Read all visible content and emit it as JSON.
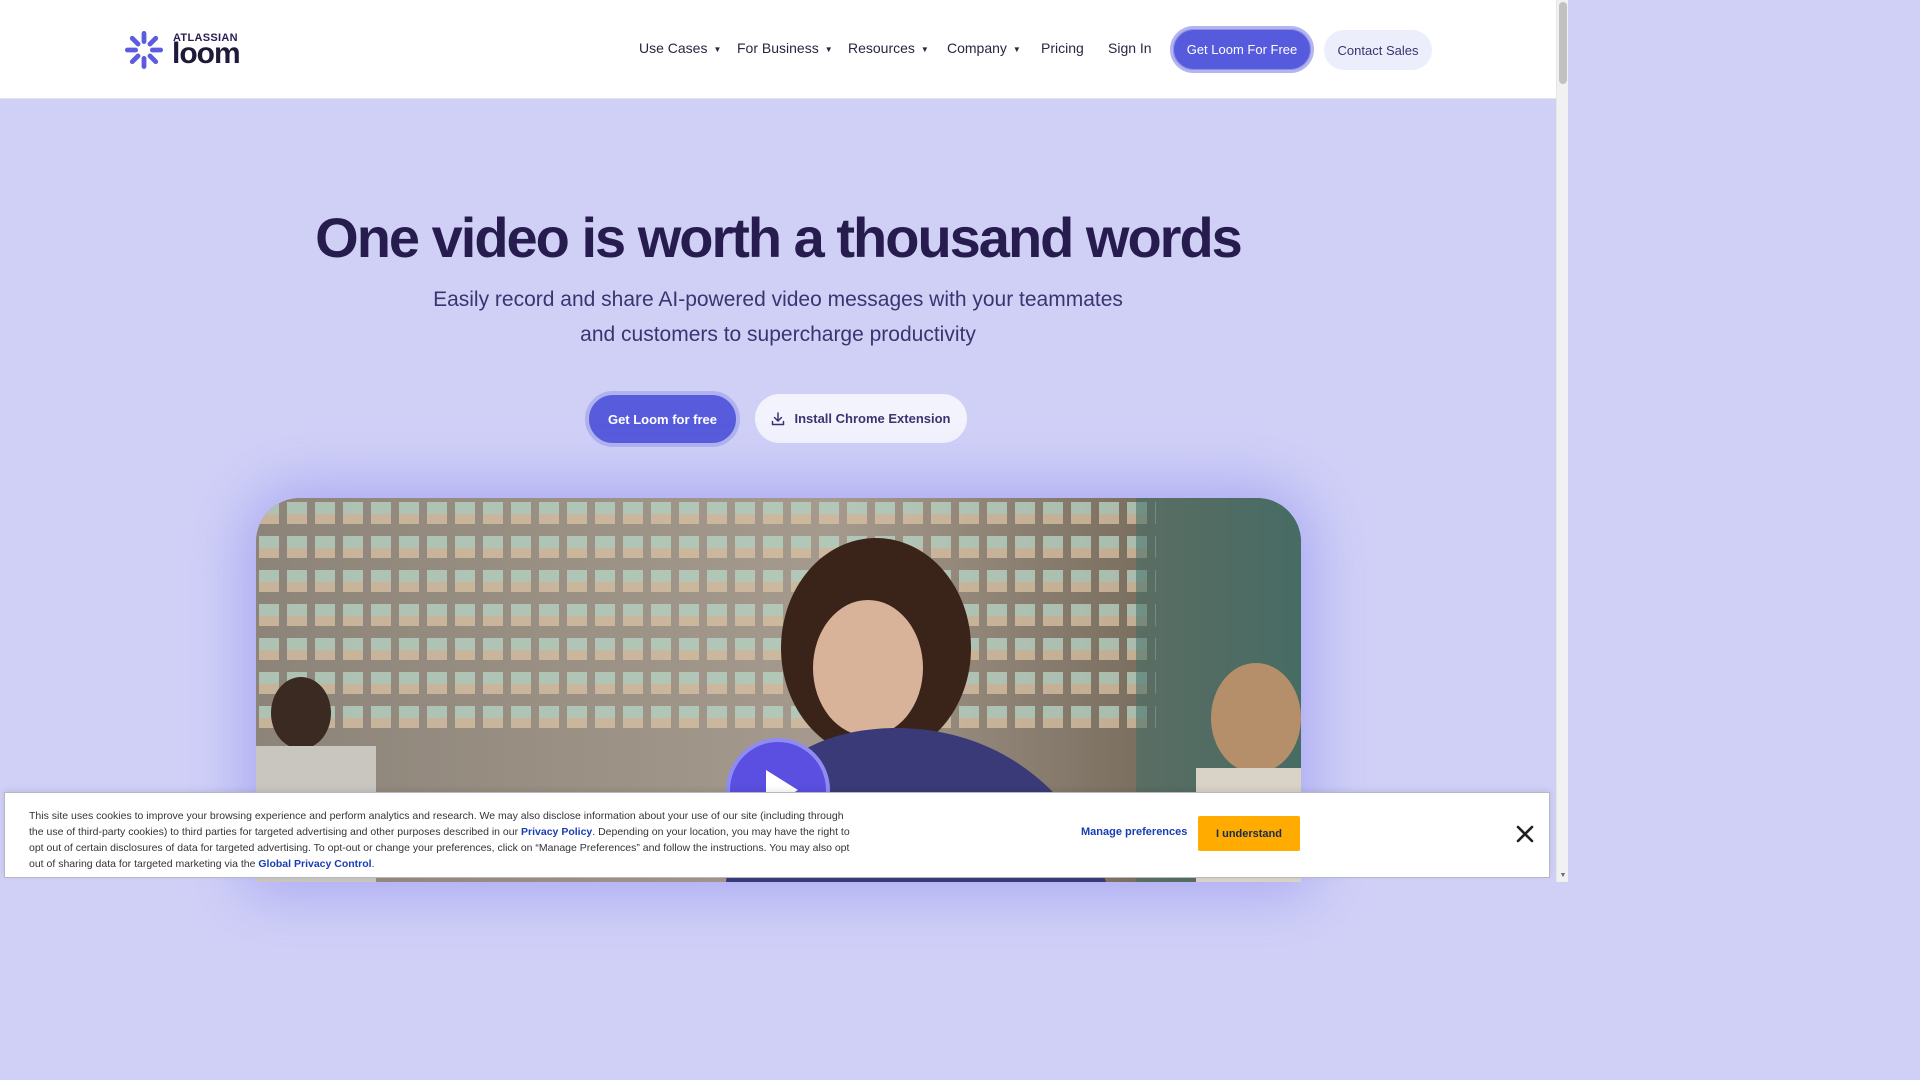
{
  "header": {
    "logo": {
      "atlassian": "ATLASSIAN",
      "loom": "loom"
    },
    "nav": [
      {
        "label": "Use Cases",
        "dropdown": true
      },
      {
        "label": "For Business",
        "dropdown": true
      },
      {
        "label": "Resources",
        "dropdown": true
      },
      {
        "label": "Company",
        "dropdown": true
      },
      {
        "label": "Pricing",
        "dropdown": false
      },
      {
        "label": "Sign In",
        "dropdown": false
      }
    ],
    "cta_primary": "Get Loom For Free",
    "cta_secondary": "Contact Sales"
  },
  "hero": {
    "title": "One video is worth a thousand words",
    "subtitle": "Easily record and share AI-powered video messages with your teammates and customers to supercharge productivity",
    "cta_primary": "Get Loom for free",
    "cta_secondary": "Install Chrome Extension"
  },
  "video": {
    "play_icon": "play-icon"
  },
  "cookie_banner": {
    "text_part1": "This site uses cookies to improve your browsing experience and perform analytics and research. We may also disclose information about your use of our site (including through the use of third-party cookies) to third parties for targeted advertising and other purposes described in our ",
    "privacy_link": "Privacy Policy",
    "text_part2": ". Depending on your location, you may have the right to opt out of certain disclosures of data for targeted advertising. To opt-out or change your preferences, click on “Manage Preferences” and follow the instructions. You may also opt out of sharing data for targeted marketing via the ",
    "gpc_link": "Global Privacy Control",
    "text_part3": ".",
    "manage_label": "Manage preferences",
    "accept_label": "I understand"
  },
  "colors": {
    "brand": "#565add",
    "hero_bg": "#d0d0f7",
    "accept": "#ffab00",
    "title": "#261c4d"
  }
}
